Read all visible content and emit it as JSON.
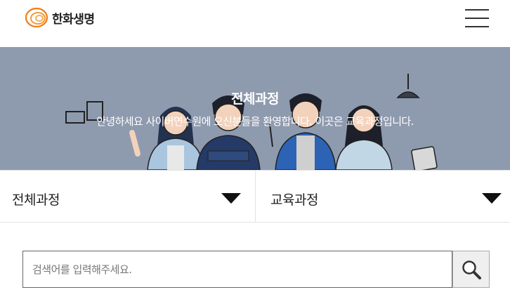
{
  "header": {
    "logo_text": "한화생명",
    "logo_icon": "hanwha-logo-icon",
    "menu_icon": "hamburger-menu-icon",
    "brand_color": "#ee7d18"
  },
  "banner": {
    "title": "전체과정",
    "subtitle": "안녕하세요 사이버연수원에 오신분들을 환영합니다. 이곳은 교육과정입니다.",
    "background_color": "#8e9aae"
  },
  "filters": {
    "category": {
      "selected": "전체과정",
      "icon": "caret-down-icon"
    },
    "type": {
      "selected": "교육과정",
      "icon": "caret-down-icon"
    }
  },
  "search": {
    "placeholder": "검색어를 입력해주세요.",
    "value": "",
    "button_icon": "search-icon"
  }
}
